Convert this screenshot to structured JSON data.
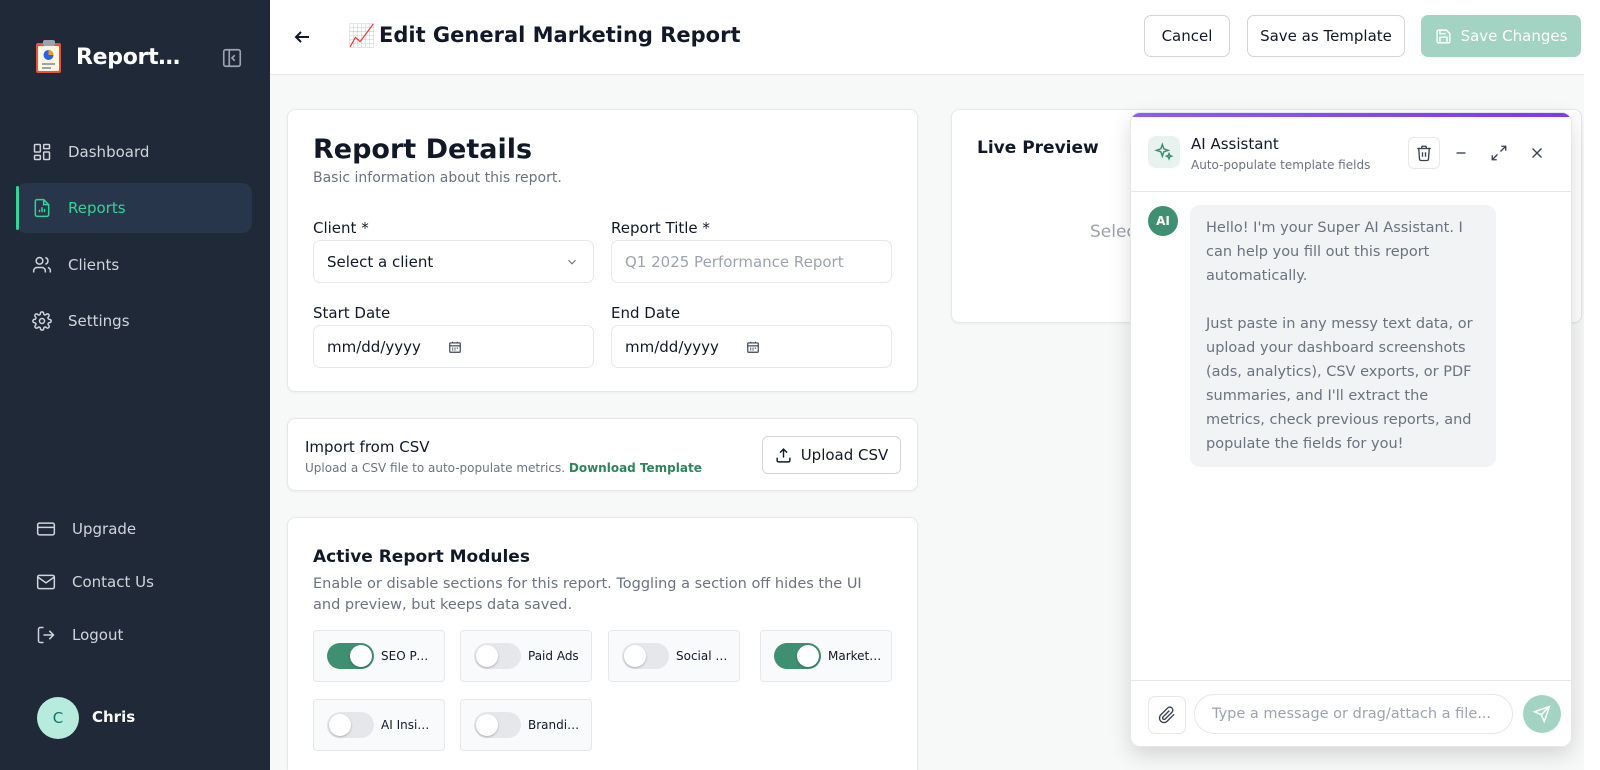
{
  "sidebar": {
    "brand": "ReportNest",
    "nav": [
      {
        "label": "Dashboard",
        "icon": "dashboard-icon"
      },
      {
        "label": "Reports",
        "icon": "report-icon",
        "active": true
      },
      {
        "label": "Clients",
        "icon": "users-icon"
      },
      {
        "label": "Settings",
        "icon": "gear-icon"
      }
    ],
    "footer_nav": [
      {
        "label": "Upgrade",
        "icon": "credit-card-icon"
      },
      {
        "label": "Contact Us",
        "icon": "mail-icon"
      },
      {
        "label": "Logout",
        "icon": "logout-icon"
      }
    ],
    "user": {
      "initial": "C",
      "name": "Chris"
    }
  },
  "header": {
    "title_emoji": "📈",
    "title": "Edit General Marketing Report",
    "cancel_label": "Cancel",
    "template_label": "Save as Template",
    "save_label": "Save Changes"
  },
  "details": {
    "title": "Report Details",
    "subtitle": "Basic information about this report.",
    "client_label": "Client *",
    "client_value": "Select a client",
    "report_title_label": "Report Title *",
    "report_title_placeholder": "Q1 2025 Performance Report",
    "start_label": "Start Date",
    "start_value": "mm/dd/yyyy",
    "end_label": "End Date",
    "end_value": "mm/dd/yyyy"
  },
  "csv": {
    "title": "Import from CSV",
    "subtitle": "Upload a CSV file to auto-populate metrics.",
    "download_label": "Download Template",
    "upload_label": "Upload CSV"
  },
  "modules": {
    "title": "Active Report Modules",
    "subtitle": "Enable or disable sections for this report. Toggling a section off hides the UI and preview, but keeps data saved.",
    "items": [
      {
        "label": "SEO Performance",
        "on": true
      },
      {
        "label": "Paid Ads",
        "on": false
      },
      {
        "label": "Social Media",
        "on": false
      },
      {
        "label": "Marketing",
        "on": true
      },
      {
        "label": "AI Insights",
        "on": false
      },
      {
        "label": "Branding",
        "on": false
      }
    ]
  },
  "preview": {
    "title": "Live Preview",
    "message": "Select"
  },
  "assistant": {
    "title": "AI Assistant",
    "subtitle": "Auto-populate template fields",
    "avatar": "AI",
    "message_p1": "Hello! I'm your Super AI Assistant. I can help you fill out this report automatically.",
    "message_p2": "Just paste in any messy text data, or upload your dashboard screenshots (ads, analytics), CSV exports, or PDF summaries, and I'll extract the metrics, check previous reports, and populate the fields for you!",
    "input_placeholder": "Type a message or drag/attach a file..."
  },
  "colors": {
    "sidebar_bg": "#1f2937",
    "accent": "#34d399",
    "primary": "#3f8f72",
    "primary_disabled": "#a3d3c2"
  }
}
